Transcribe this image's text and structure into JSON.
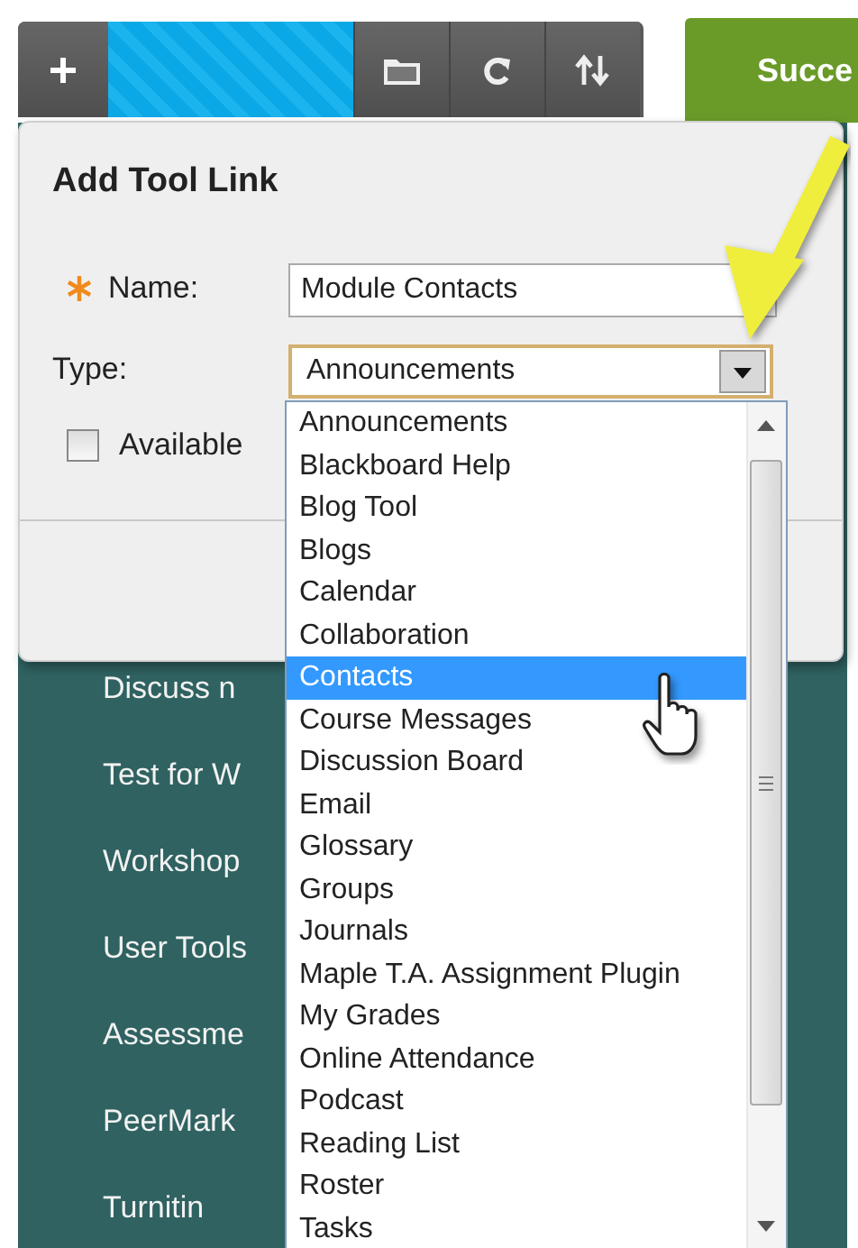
{
  "success_button": {
    "label": "Succe"
  },
  "dialog": {
    "title": "Add Tool Link",
    "fields": [
      {
        "kind": "text",
        "label": "Name:",
        "required": true,
        "value": "Module Contacts"
      },
      {
        "kind": "select",
        "label": "Type:",
        "required": false,
        "value": "Announcements",
        "expanded": true
      }
    ],
    "checkbox": {
      "label": "Available",
      "checked": false
    }
  },
  "dropdown": {
    "options": [
      {
        "label": "Announcements",
        "selected": false
      },
      {
        "label": "Blackboard Help",
        "selected": false
      },
      {
        "label": "Blog Tool",
        "selected": false
      },
      {
        "label": "Blogs",
        "selected": false
      },
      {
        "label": "Calendar",
        "selected": false
      },
      {
        "label": "Collaboration",
        "selected": false
      },
      {
        "label": "Contacts",
        "selected": true
      },
      {
        "label": "Course Messages",
        "selected": false
      },
      {
        "label": "Discussion Board",
        "selected": false
      },
      {
        "label": "Email",
        "selected": false
      },
      {
        "label": "Glossary",
        "selected": false
      },
      {
        "label": "Groups",
        "selected": false
      },
      {
        "label": "Journals",
        "selected": false
      },
      {
        "label": "Maple T.A. Assignment Plugin",
        "selected": false
      },
      {
        "label": "My Grades",
        "selected": false
      },
      {
        "label": "Online Attendance",
        "selected": false
      },
      {
        "label": "Podcast",
        "selected": false
      },
      {
        "label": "Reading List",
        "selected": false
      },
      {
        "label": "Roster",
        "selected": false
      },
      {
        "label": "Tasks",
        "selected": false
      }
    ]
  },
  "sidebar": {
    "items": [
      {
        "label": "Discuss n"
      },
      {
        "label": "Test for W"
      },
      {
        "label": "Workshop"
      },
      {
        "label": "User Tools"
      },
      {
        "label": "Assessme"
      },
      {
        "label": "PeerMark"
      },
      {
        "label": "Turnitin"
      }
    ]
  }
}
